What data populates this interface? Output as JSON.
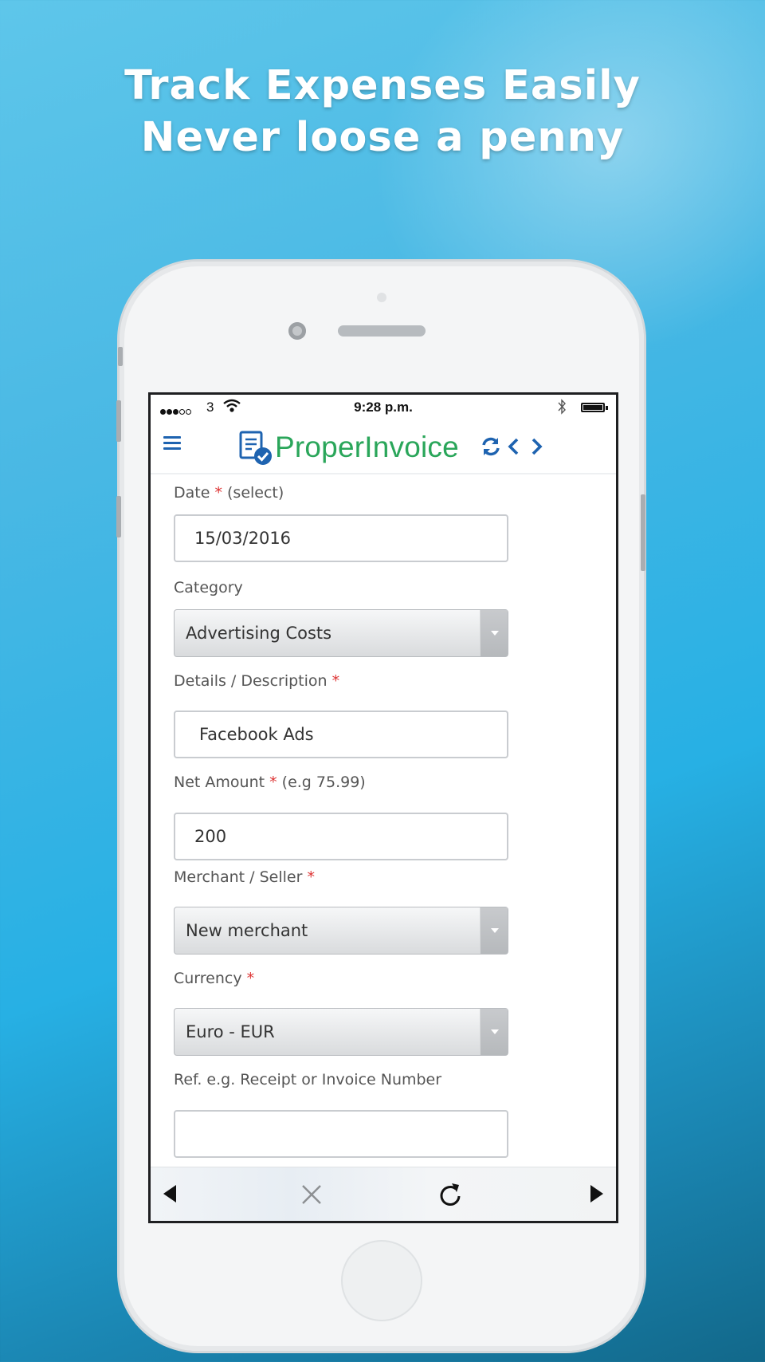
{
  "promo": {
    "line1": "Track Expenses Easily",
    "line2": "Never loose a penny"
  },
  "status_bar": {
    "carrier": "3",
    "time": "9:28 p.m."
  },
  "header": {
    "logo_text": "ProperInvoice",
    "brand_color": "#2aa65a",
    "icon_color": "#1e63b0"
  },
  "form": {
    "date": {
      "label": "Date",
      "required": "*",
      "hint": "(select)",
      "value": "15/03/2016"
    },
    "category": {
      "label": "Category",
      "value": "Advertising Costs"
    },
    "details": {
      "label": "Details / Description",
      "required": "*",
      "value": "Facebook Ads"
    },
    "net_amount": {
      "label": "Net Amount",
      "required": "*",
      "hint": "(e.g 75.99)",
      "value": "200"
    },
    "merchant": {
      "label": "Merchant / Seller",
      "required": "*",
      "value": "New merchant"
    },
    "currency": {
      "label": "Currency",
      "required": "*",
      "value": "Euro - EUR"
    },
    "reference": {
      "label": "Ref. e.g. Receipt or Invoice Number",
      "value": ""
    }
  },
  "toolbar": {
    "icons": [
      "back-icon",
      "close-icon",
      "reload-icon",
      "forward-icon"
    ]
  }
}
